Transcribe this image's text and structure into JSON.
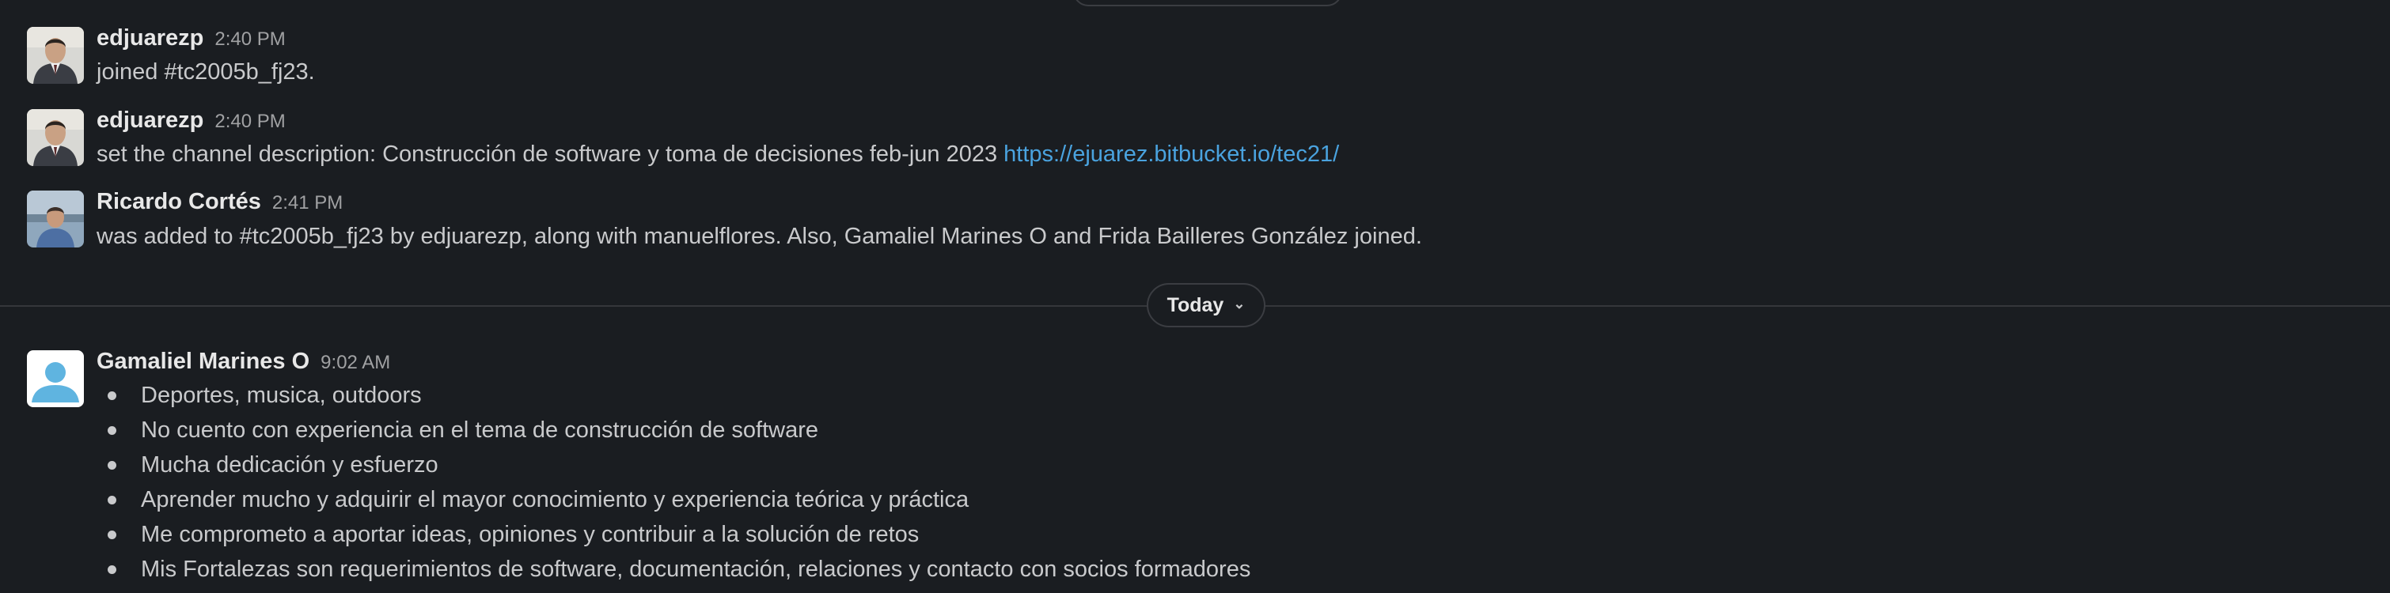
{
  "messages": [
    {
      "author": "edjuarezp",
      "time": "2:40 PM",
      "text": "joined #tc2005b_fj23."
    },
    {
      "author": "edjuarezp",
      "time": "2:40 PM",
      "text": "set the channel description: Construcción de software y toma de decisiones feb-jun 2023 ",
      "link": "https://ejuarez.bitbucket.io/tec21/"
    },
    {
      "author": "Ricardo Cortés",
      "time": "2:41 PM",
      "text": "was added to #tc2005b_fj23 by edjuarezp, along with manuelflores. Also, Gamaliel Marines O and Frida Bailleres González joined."
    }
  ],
  "divider": {
    "label": "Today",
    "chevron_icon": "chevron-down-icon"
  },
  "post": {
    "author": "Gamaliel Marines O",
    "time": "9:02 AM",
    "bullets": [
      "Deportes, musica, outdoors",
      "No cuento con experiencia en el tema de construcción de software",
      "Mucha dedicación y esfuerzo",
      "Aprender mucho y adquirir el mayor conocimiento y experiencia teórica y práctica",
      "Me comprometo a aportar ideas, opiniones y contribuir a la solución de retos",
      "Mis Fortalezas son requerimientos de software, documentación, relaciones y contacto con socios formadores"
    ]
  },
  "colors": {
    "background": "#1a1d21",
    "link": "#4aa3df",
    "default_avatar": "#5fb4e0"
  }
}
